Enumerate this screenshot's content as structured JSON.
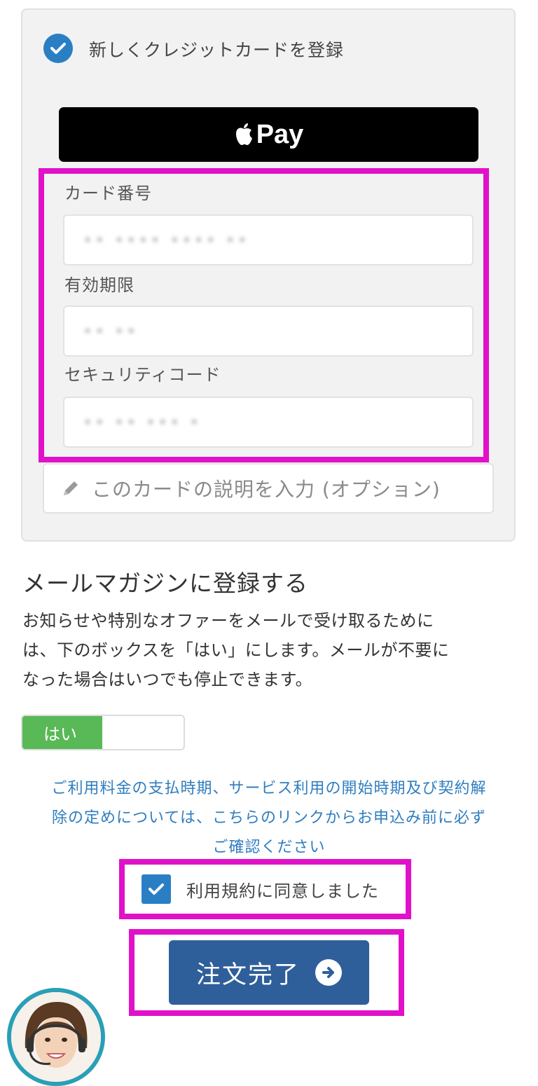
{
  "payment": {
    "new_card_label": "新しくクレジットカードを登録",
    "apple_pay_label": "Pay",
    "card_number_label": "カード番号",
    "card_number_value": "•• •••• •••• ••",
    "expiry_label": "有効期限",
    "expiry_value": "•• ••",
    "security_code_label": "セキュリティコード",
    "security_code_value": "•• •• ••• •",
    "card_description_placeholder": "このカードの説明を入力 (オプション)"
  },
  "newsletter": {
    "title": "メールマガジンに登録する",
    "body_line1": "お知らせや特別なオファーをメールで受け取るために",
    "body_line2": "は、下のボックスを「はい」にします。メールが不要に",
    "body_line3": "なった場合はいつでも停止できます。",
    "toggle_label": "はい"
  },
  "terms": {
    "notice_line1": "ご利用料金の支払時期、サービス利用の開始時期及び契約解",
    "notice_line2": "除の定めについては、こちらのリンクからお申込み前に必ず",
    "notice_line3": "ご確認ください",
    "agree_label": "利用規約に同意しました"
  },
  "order": {
    "submit_label": "注文完了"
  },
  "colors": {
    "accent": "#2a7fc4",
    "highlight": "#e011c8",
    "toggle_on": "#58b956",
    "button": "#2f5f9a",
    "link": "#2f7dbf"
  }
}
